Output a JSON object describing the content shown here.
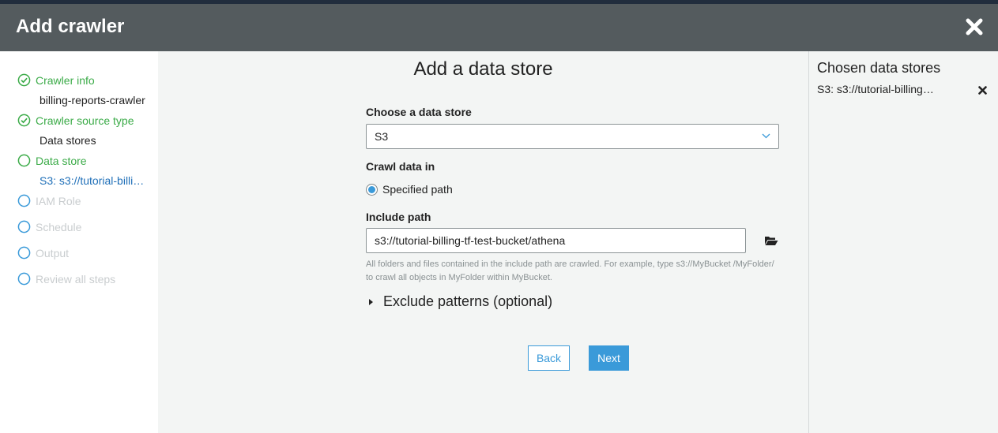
{
  "header": {
    "title": "Add crawler",
    "close_icon": "close-icon"
  },
  "sidebar": {
    "steps": [
      {
        "label": "Crawler info",
        "status": "complete",
        "value": "billing-reports-crawler"
      },
      {
        "label": "Crawler source type",
        "status": "complete",
        "value": "Data stores"
      },
      {
        "label": "Data store",
        "status": "current",
        "value": "S3: s3://tutorial-billi…"
      },
      {
        "label": "IAM Role",
        "status": "pending"
      },
      {
        "label": "Schedule",
        "status": "pending"
      },
      {
        "label": "Output",
        "status": "pending"
      },
      {
        "label": "Review all steps",
        "status": "pending"
      }
    ]
  },
  "main": {
    "title": "Add a data store",
    "data_store_label": "Choose a data store",
    "data_store_value": "S3",
    "crawl_data_label": "Crawl data in",
    "crawl_option": "Specified path",
    "include_path_label": "Include path",
    "include_path_value": "s3://tutorial-billing-tf-test-bucket/athena",
    "help_text": "All folders and files contained in the include path are crawled. For example, type s3://MyBucket /MyFolder/ to crawl all objects in MyFolder within MyBucket.",
    "exclude_label": "Exclude patterns (optional)",
    "back_label": "Back",
    "next_label": "Next"
  },
  "right_panel": {
    "title": "Chosen data stores",
    "items": [
      {
        "label": "S3: s3://tutorial-billing…"
      }
    ]
  },
  "colors": {
    "header_bg": "#545b5e",
    "top_strip": "#212d3d",
    "accent": "#3a9ad9",
    "complete": "#3bab48",
    "pending_text": "#c9cdcf",
    "link": "#1f6fb8"
  }
}
